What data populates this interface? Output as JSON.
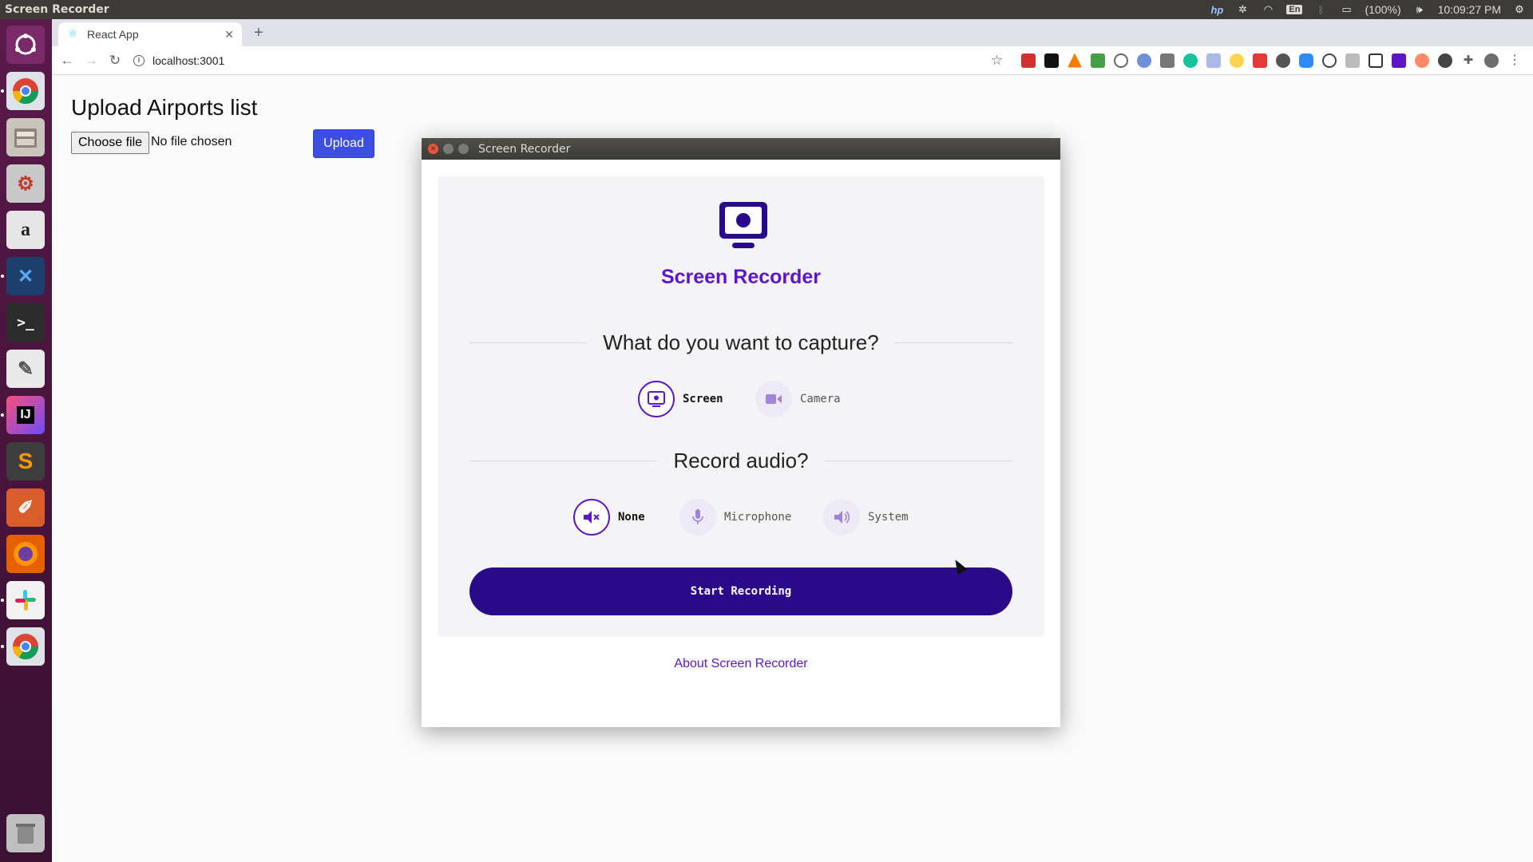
{
  "topbar": {
    "app_title": "Screen Recorder",
    "keyboard_layout": "En",
    "battery": "(100%)",
    "clock": "10:09:27 PM"
  },
  "browser": {
    "tab_title": "React App",
    "new_tab": "+",
    "url": "localhost:3001"
  },
  "page": {
    "title": "Upload Airports list",
    "choose_file_label": "Choose file",
    "no_file_text": "No file chosen",
    "upload_label": "Upload"
  },
  "recorder": {
    "window_title": "Screen Recorder",
    "app_name": "Screen Recorder",
    "capture_question": "What do you want to capture?",
    "capture_options": [
      {
        "label": "Screen",
        "icon": "monitor-icon",
        "selected": true
      },
      {
        "label": "Camera",
        "icon": "camera-icon",
        "selected": false
      }
    ],
    "audio_question": "Record audio?",
    "audio_options": [
      {
        "label": "None",
        "icon": "muted-speaker-icon",
        "selected": true
      },
      {
        "label": "Microphone",
        "icon": "microphone-icon",
        "selected": false
      },
      {
        "label": "System",
        "icon": "speaker-icon",
        "selected": false
      }
    ],
    "start_label": "Start Recording",
    "about_label": "About Screen Recorder"
  },
  "colors": {
    "accent": "#5b16c8",
    "button_dark": "#2a0a8a",
    "upload_button": "#3d4fe0",
    "launcher": "#4b1540"
  }
}
